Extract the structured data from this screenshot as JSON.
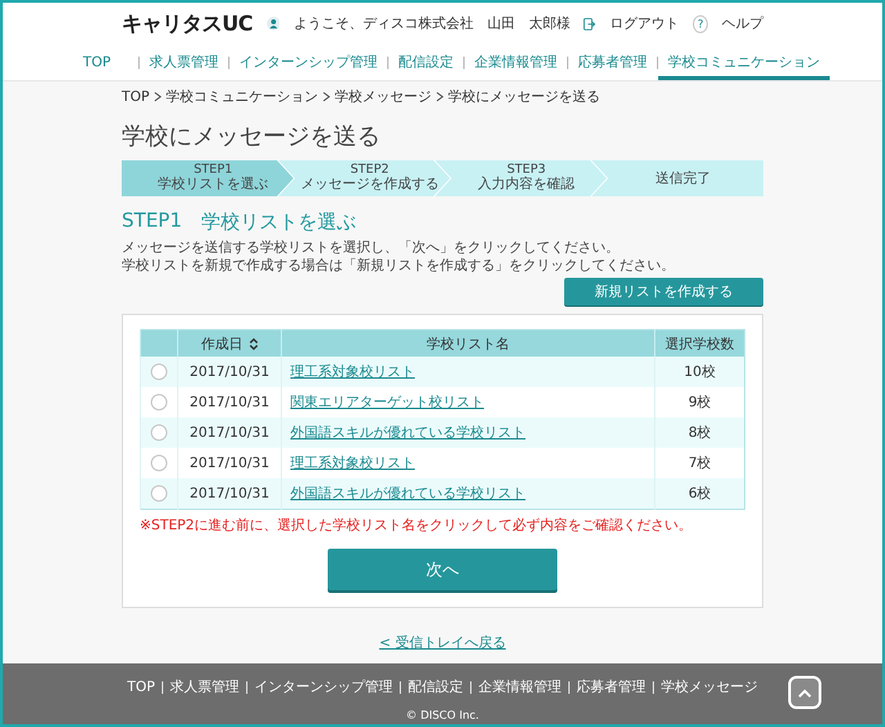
{
  "header": {
    "logo": "キャリタスUC",
    "welcome": "ようこそ、ディスコ株式会社　山田　太郎様",
    "logout": "ログアウト",
    "help_icon": "?",
    "help": "ヘルプ"
  },
  "nav": [
    {
      "label": "TOP",
      "selected": false
    },
    {
      "label": "求人票管理",
      "selected": false
    },
    {
      "label": "インターンシップ管理",
      "selected": false
    },
    {
      "label": "配信設定",
      "selected": false
    },
    {
      "label": "企業情報管理",
      "selected": false
    },
    {
      "label": "応募者管理",
      "selected": false
    },
    {
      "label": "学校コミュニケーション",
      "selected": true
    }
  ],
  "breadcrumb": [
    "TOP",
    "学校コミュニケーション",
    "学校メッセージ",
    "学校にメッセージを送る"
  ],
  "page_title": "学校にメッセージを送る",
  "steps": [
    {
      "title": "STEP1",
      "subtitle": "学校リストを選ぶ",
      "selected": true
    },
    {
      "title": "STEP2",
      "subtitle": "メッセージを作成する",
      "selected": false
    },
    {
      "title": "STEP3",
      "subtitle": "入力内容を確認",
      "selected": false
    },
    {
      "title": "送信完了",
      "selected": false
    }
  ],
  "section": {
    "step": "STEP1",
    "title": "学校リストを選ぶ"
  },
  "instructions": [
    "メッセージを送信する学校リストを選択し、「次へ」をクリックしてください。",
    "学校リストを新規で作成する場合は「新規リストを作成する」をクリックしてください。"
  ],
  "new_list_button": "新規リストを作成する",
  "table": {
    "columns": [
      {
        "label": "作成日",
        "sortable": true
      },
      {
        "label": "学校リスト名",
        "sortable": false
      },
      {
        "label": "選択学校数",
        "sortable": false
      }
    ],
    "rows": [
      {
        "selected": false,
        "date": "2017/10/31",
        "name": "理工系対象校リスト",
        "count": "10校"
      },
      {
        "selected": false,
        "date": "2017/10/31",
        "name": "関東エリアターゲット校リスト",
        "count": "9校"
      },
      {
        "selected": false,
        "date": "2017/10/31",
        "name": "外国語スキルが優れている学校リスト",
        "count": "8校"
      },
      {
        "selected": false,
        "date": "2017/10/31",
        "name": "理工系対象校リスト",
        "count": "7校"
      },
      {
        "selected": false,
        "date": "2017/10/31",
        "name": "外国語スキルが優れている学校リスト",
        "count": "6校"
      }
    ]
  },
  "note": "※STEP2に進む前に、選択した学校リスト名をクリックして必ず内容をご確認ください。",
  "next_button": "次へ",
  "back_link": "< 受信トレイへ戻る",
  "footer": {
    "links": [
      "TOP",
      "求人票管理",
      "インターンシップ管理",
      "配信設定",
      "企業情報管理",
      "応募者管理",
      "学校メッセージ"
    ],
    "copyright": "© DISCO Inc."
  }
}
